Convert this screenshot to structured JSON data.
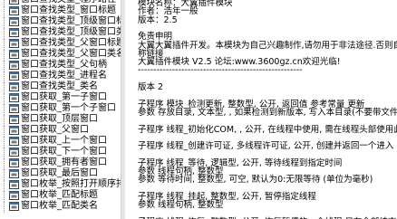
{
  "tree": {
    "items": [
      {
        "label": "窗口查找类型_程序路径",
        "icon": "window-icon"
      },
      {
        "label": "窗口查找类型_窗口标题",
        "icon": "window-icon"
      },
      {
        "label": "窗口查找类型_顶级窗口标",
        "icon": "window-icon"
      },
      {
        "label": "窗口查找类型_顶级窗口类",
        "icon": "window-icon"
      },
      {
        "label": "窗口查找类型_父窗口标题",
        "icon": "window-icon"
      },
      {
        "label": "窗口查找类型_父窗口类名",
        "icon": "window-icon"
      },
      {
        "label": "窗口查找类型_父句柄",
        "icon": "window-icon"
      },
      {
        "label": "窗口查找类型_进程名",
        "icon": "window-icon"
      },
      {
        "label": "窗口查找类型_类名",
        "icon": "window-icon"
      },
      {
        "label": "窗口获取_第一子窗口",
        "icon": "window-icon"
      },
      {
        "label": "窗口获取_第一个子窗口",
        "icon": "window-icon"
      },
      {
        "label": "窗口获取_顶层窗口",
        "icon": "window-icon"
      },
      {
        "label": "窗口获取_父窗口",
        "icon": "window-icon"
      },
      {
        "label": "窗口获取_上一个窗口",
        "icon": "window-icon"
      },
      {
        "label": "窗口获取_下一个窗口",
        "icon": "window-icon"
      },
      {
        "label": "窗口获取_拥有者窗口",
        "icon": "window-icon"
      },
      {
        "label": "窗口获取_最后窗口",
        "icon": "window-icon"
      },
      {
        "label": "窗口枚举_按照打开顺序排",
        "icon": "window-icon"
      },
      {
        "label": "窗口枚举_匹配标题",
        "icon": "window-icon"
      },
      {
        "label": "窗口枚举_匹配类名",
        "icon": "window-icon"
      }
    ]
  },
  "editor": {
    "lines": [
      {
        "text": "模块名称：大翼插件模块"
      },
      {
        "text": "作者：浩年一般"
      },
      {
        "text": "版本：2.5"
      },
      {
        "text": ""
      },
      {
        "text": "免责申明"
      },
      {
        "text": "大翼大翼插件开发。本模块为自己兴趣制作,请勿用于非法途径.否则自负"
      },
      {
        "text": "称链接"
      },
      {
        "text": "大翼插件模块 V2.5  论坛:www.3600gz.cn欢迎光临!"
      },
      {
        "text": "-----------------------------------------------------"
      },
      {
        "text": ""
      },
      {
        "text": "版本 2"
      },
      {
        "text": ""
      },
      {
        "text": "子程序 模块_检测更新,  整数型, 公开, 返回值 参考常量 更新"
      },
      {
        "text": "参数 存放目录, 文本型, , 如果检测到新版本, 写入本目录(不要带文件"
      },
      {
        "text": ""
      },
      {
        "text": "子程序 线程_初始化COM, , 公开, 在线程中使用, 需在线程头部使用此"
      },
      {
        "text": ""
      },
      {
        "text": "子程序 线程_创建许可证, 多线程许可证, 公开, 创建并返回一个进入"
      },
      {
        "text": ""
      },
      {
        "text": "子程序 线程_等待, 逻辑型, 公开, 等待线程到指定时间"
      },
      {
        "text": "参数 线程句柄, 整数型"
      },
      {
        "text": "参数 等待时间, 整数型, 可空, 默认为0:无限等待 (单位为毫秒)"
      },
      {
        "text": ""
      },
      {
        "text": "子程序 线程_挂起, 整数型, 公开, 暂停指定线程"
      },
      {
        "text": "参数 线程句柄, 整数型"
      },
      {
        "text": ""
      },
      {
        "text": "子程序 线程_恢复, 整数型, 公开, 恢复暂停的一个线程 只有全部结束"
      }
    ]
  }
}
